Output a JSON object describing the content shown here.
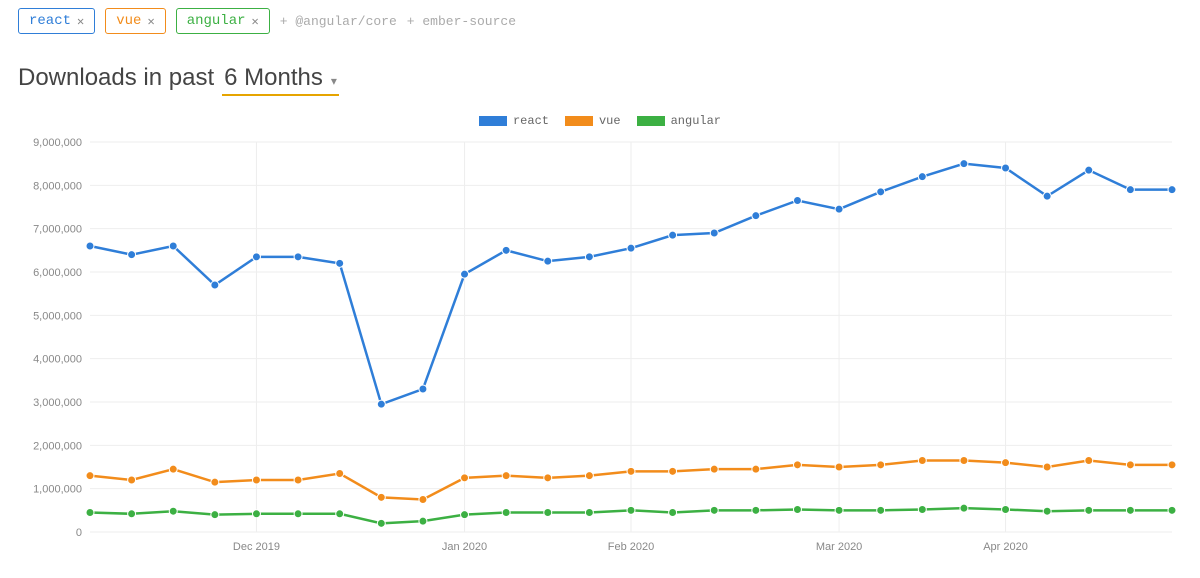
{
  "tags": [
    {
      "label": "react",
      "color": "#2f7ed8"
    },
    {
      "label": "vue",
      "color": "#f28c1b"
    },
    {
      "label": "angular",
      "color": "#3cb043"
    }
  ],
  "suggestions": [
    {
      "label": "+ @angular/core"
    },
    {
      "label": "+ ember-source"
    }
  ],
  "title_prefix": "Downloads in past",
  "dropdown_value": "6 Months",
  "chart_data": {
    "type": "line",
    "ylabel": "",
    "xlabel": "",
    "ylim": [
      0,
      9000000
    ],
    "yticks": [
      0,
      1000000,
      2000000,
      3000000,
      4000000,
      5000000,
      6000000,
      7000000,
      8000000,
      9000000
    ],
    "x_count": 27,
    "x_tick_labels": {
      "4": "Dec 2019",
      "9": "Jan 2020",
      "13": "Feb 2020",
      "18": "Mar 2020",
      "22": "Apr 2020"
    },
    "series": [
      {
        "name": "react",
        "color": "#2f7ed8",
        "values": [
          6600000,
          6400000,
          6600000,
          5700000,
          6350000,
          6350000,
          6200000,
          2950000,
          3300000,
          5950000,
          6500000,
          6250000,
          6350000,
          6550000,
          6850000,
          6900000,
          7300000,
          7650000,
          7450000,
          7850000,
          8200000,
          8500000,
          8400000,
          7750000,
          8350000,
          7900000,
          7900000
        ]
      },
      {
        "name": "vue",
        "color": "#f28c1b",
        "values": [
          1300000,
          1200000,
          1450000,
          1150000,
          1200000,
          1200000,
          1350000,
          800000,
          750000,
          1250000,
          1300000,
          1250000,
          1300000,
          1400000,
          1400000,
          1450000,
          1450000,
          1550000,
          1500000,
          1550000,
          1650000,
          1650000,
          1600000,
          1500000,
          1650000,
          1550000,
          1550000
        ]
      },
      {
        "name": "angular",
        "color": "#3cb043",
        "values": [
          450000,
          420000,
          480000,
          400000,
          420000,
          420000,
          420000,
          200000,
          250000,
          400000,
          450000,
          450000,
          450000,
          500000,
          450000,
          500000,
          500000,
          520000,
          500000,
          500000,
          520000,
          550000,
          520000,
          480000,
          500000,
          500000,
          500000
        ]
      }
    ]
  }
}
